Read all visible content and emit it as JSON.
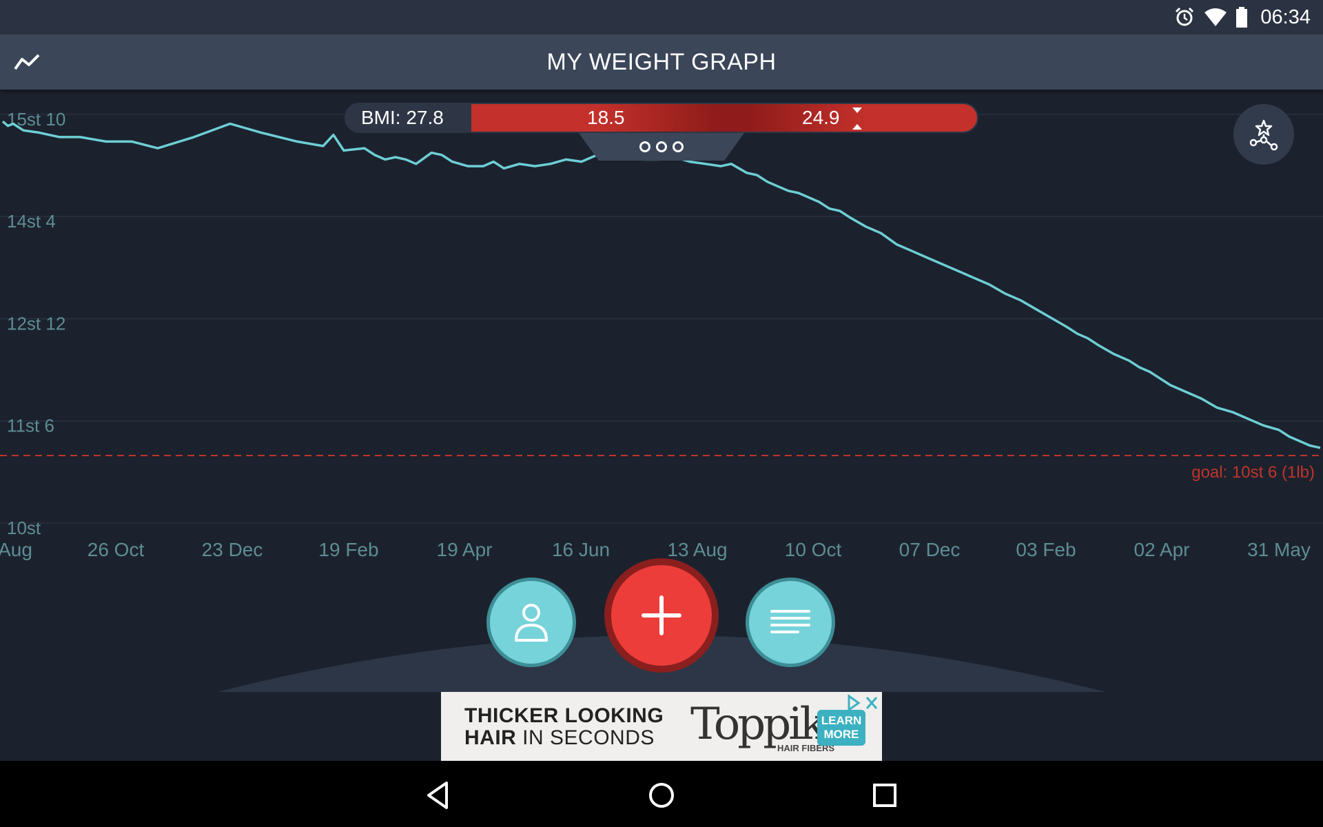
{
  "status_bar": {
    "time": "06:34",
    "icons": [
      "alarm-icon",
      "wifi-icon",
      "battery-icon"
    ]
  },
  "app_bar": {
    "title": "MY WEIGHT GRAPH",
    "left_icon": "trend-line-icon"
  },
  "bmi": {
    "label": "BMI: 27.8",
    "low_threshold": "18.5",
    "high_threshold": "24.9",
    "value": 27.8
  },
  "colors": {
    "line": "#6dcfd5",
    "goal": "#c0332d",
    "accent_red": "#ec3d3a",
    "teal": "#76d3da"
  },
  "chart_data": {
    "type": "line",
    "y_ticks": [
      "15st 10",
      "14st 4",
      "12st 12",
      "11st 6",
      "10st"
    ],
    "ylim_lbs": [
      140,
      227
    ],
    "x_ticks": [
      "Aug",
      "26 Oct",
      "23 Dec",
      "19 Feb",
      "19 Apr",
      "16 Jun",
      "13 Aug",
      "10 Oct",
      "07 Dec",
      "03 Feb",
      "02 Apr",
      "31 May"
    ],
    "goal_label": "goal: 10st 6 (1lb)",
    "goal_lbs": 146,
    "series": [
      {
        "points": [
          [
            0,
            219.5
          ],
          [
            1,
            218.5
          ],
          [
            2,
            219.0
          ],
          [
            4,
            217.5
          ],
          [
            7,
            217.0
          ],
          [
            11,
            216.0
          ],
          [
            15,
            216.0
          ],
          [
            20,
            215.0
          ],
          [
            25,
            215.0
          ],
          [
            30,
            213.5
          ],
          [
            37,
            216.0
          ],
          [
            44,
            219.0
          ],
          [
            50,
            217.0
          ],
          [
            57,
            215.0
          ],
          [
            62,
            214.0
          ],
          [
            64,
            216.5
          ],
          [
            66,
            213.0
          ],
          [
            70,
            213.5
          ],
          [
            72,
            212.0
          ],
          [
            74,
            211.0
          ],
          [
            76,
            211.5
          ],
          [
            78,
            211.0
          ],
          [
            80,
            210.0
          ],
          [
            83,
            212.5
          ],
          [
            85,
            212.0
          ],
          [
            87,
            210.5
          ],
          [
            90,
            209.5
          ],
          [
            93,
            209.5
          ],
          [
            95,
            210.5
          ],
          [
            97,
            209.0
          ],
          [
            100,
            210.0
          ],
          [
            103,
            209.5
          ],
          [
            106,
            210.0
          ],
          [
            109,
            211.0
          ],
          [
            112,
            210.5
          ],
          [
            115,
            212.0
          ],
          [
            118,
            211.5
          ],
          [
            121,
            212.0
          ],
          [
            124,
            211.0
          ],
          [
            127,
            211.0
          ],
          [
            130,
            211.5
          ],
          [
            133,
            210.5
          ],
          [
            136,
            210.0
          ],
          [
            139,
            209.5
          ],
          [
            141,
            210.0
          ],
          [
            144,
            208.0
          ],
          [
            146,
            207.5
          ],
          [
            148,
            206.0
          ],
          [
            150,
            205.0
          ],
          [
            152,
            204.0
          ],
          [
            154,
            203.5
          ],
          [
            156,
            202.5
          ],
          [
            158,
            201.5
          ],
          [
            160,
            200.0
          ],
          [
            162,
            199.5
          ],
          [
            164,
            198.0
          ],
          [
            167,
            196.0
          ],
          [
            170,
            194.5
          ],
          [
            173,
            192.0
          ],
          [
            176,
            190.5
          ],
          [
            179,
            189.0
          ],
          [
            182,
            187.5
          ],
          [
            185,
            186.0
          ],
          [
            188,
            184.5
          ],
          [
            191,
            183.0
          ],
          [
            194,
            181.0
          ],
          [
            197,
            179.5
          ],
          [
            200,
            177.5
          ],
          [
            203,
            175.5
          ],
          [
            206,
            173.5
          ],
          [
            208,
            172.0
          ],
          [
            210,
            171.0
          ],
          [
            212,
            169.5
          ],
          [
            215,
            167.5
          ],
          [
            218,
            166.0
          ],
          [
            220,
            164.5
          ],
          [
            222,
            163.5
          ],
          [
            224,
            162.0
          ],
          [
            226,
            160.5
          ],
          [
            228,
            159.5
          ],
          [
            230,
            158.5
          ],
          [
            232,
            157.5
          ],
          [
            235,
            155.5
          ],
          [
            238,
            154.5
          ],
          [
            241,
            153.0
          ],
          [
            244,
            151.5
          ],
          [
            247,
            150.5
          ],
          [
            249,
            149.0
          ],
          [
            251,
            148.0
          ],
          [
            253,
            147.0
          ],
          [
            255,
            146.5
          ]
        ]
      }
    ],
    "grid": true
  },
  "fabs": {
    "profile": "profile-icon",
    "add": "plus-icon",
    "log": "list-icon"
  },
  "ad": {
    "headline_line1": "THICKER LOOKING",
    "headline_line2_bold": "HAIR",
    "headline_line2_rest": " IN SECONDS",
    "brand": "Toppik",
    "tagline": "HAIR FIBERS",
    "cta_line1": "LEARN",
    "cta_line2": "MORE"
  },
  "nav": {
    "buttons": [
      "back-icon",
      "home-icon",
      "recents-icon"
    ]
  }
}
